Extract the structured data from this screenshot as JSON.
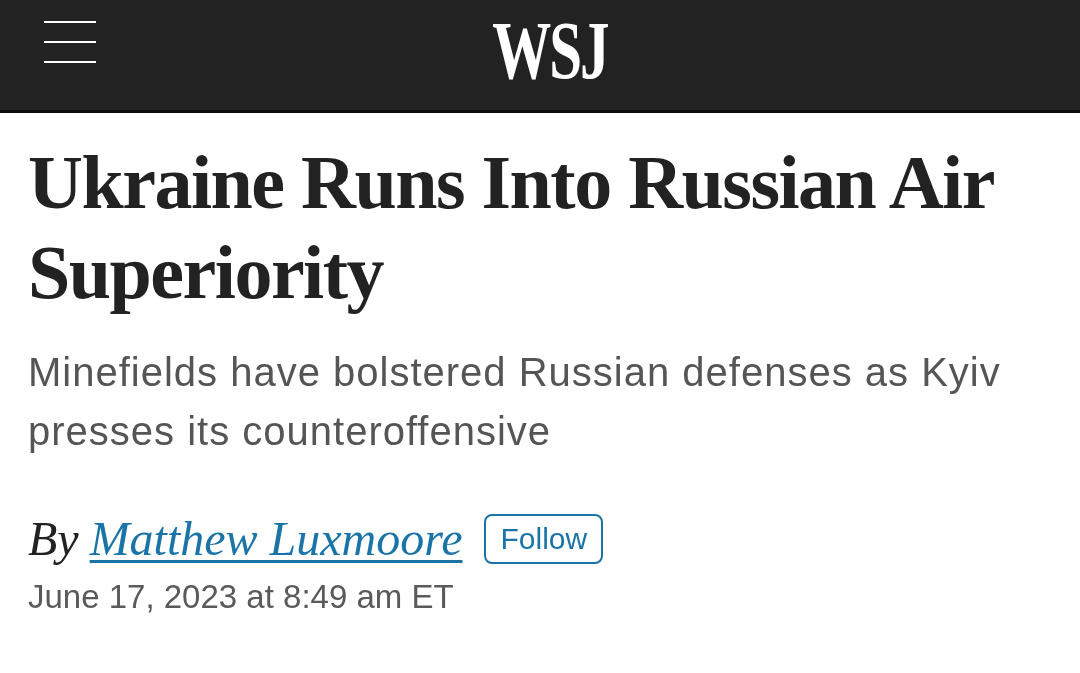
{
  "header": {
    "logo": "WSJ"
  },
  "article": {
    "headline": "Ukraine Runs Into Russian Air Superiority",
    "subheadline": "Minefields have bolstered Russian defenses as Kyiv presses its counteroffensive",
    "byline": {
      "prefix": "By",
      "author": "Matthew Luxmoore",
      "follow_button": "Follow"
    },
    "date": "June 17, 2023 at 8:49 am ET"
  }
}
